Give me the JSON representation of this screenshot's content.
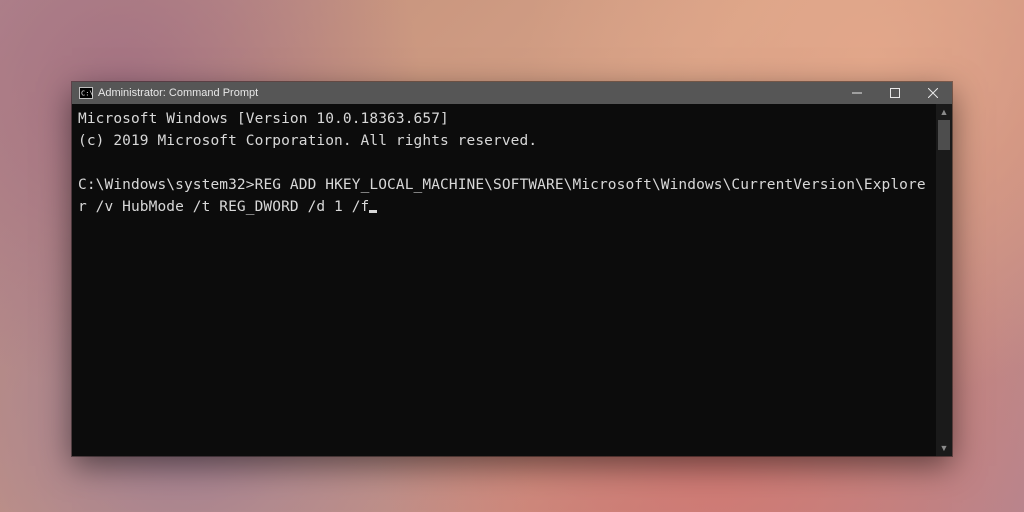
{
  "window": {
    "title": "Administrator: Command Prompt"
  },
  "terminal": {
    "banner_line1": "Microsoft Windows [Version 10.0.18363.657]",
    "banner_line2": "(c) 2019 Microsoft Corporation. All rights reserved.",
    "prompt": "C:\\Windows\\system32>",
    "command": "REG ADD HKEY_LOCAL_MACHINE\\SOFTWARE\\Microsoft\\Windows\\CurrentVersion\\Explorer /v HubMode /t REG_DWORD /d 1 /f"
  }
}
